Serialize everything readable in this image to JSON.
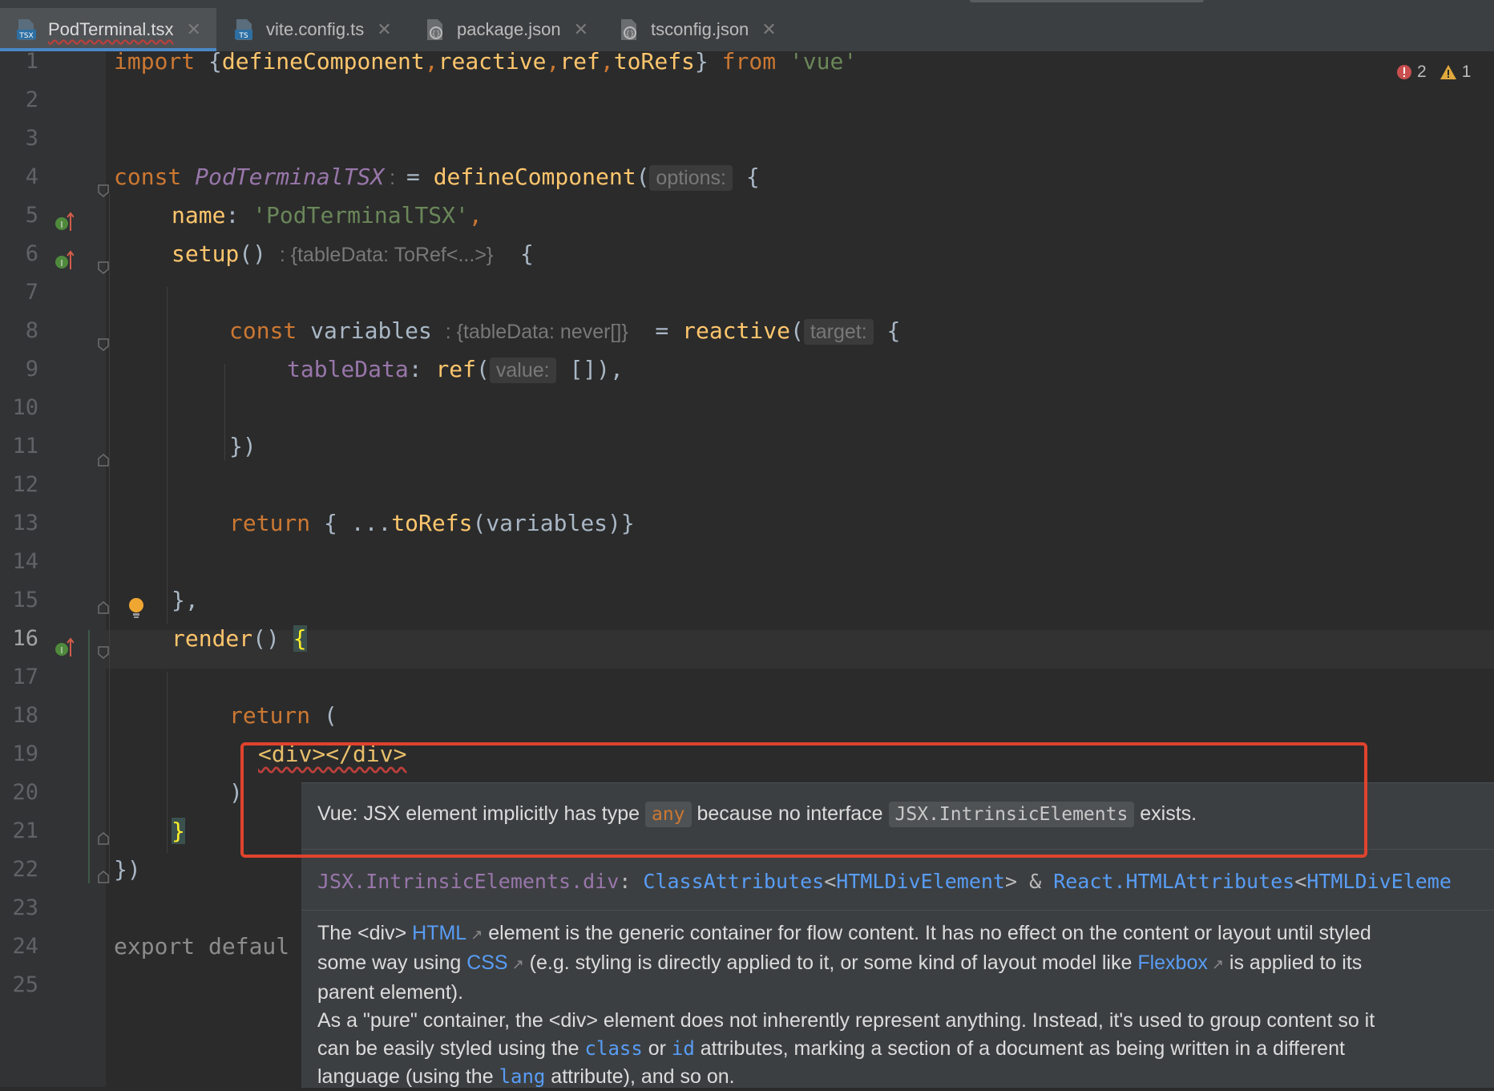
{
  "tabs": [
    {
      "label": "PodTerminal.tsx",
      "icon": "tsx-file-icon",
      "active": true
    },
    {
      "label": "vite.config.ts",
      "icon": "ts-file-icon",
      "active": false
    },
    {
      "label": "package.json",
      "icon": "json-config-icon",
      "active": false
    },
    {
      "label": "tsconfig.json",
      "icon": "json-config-icon",
      "active": false
    }
  ],
  "tab_close": "✕",
  "line_numbers": [
    "1",
    "2",
    "3",
    "4",
    "5",
    "6",
    "7",
    "8",
    "9",
    "10",
    "11",
    "12",
    "13",
    "14",
    "15",
    "16",
    "17",
    "18",
    "19",
    "20",
    "21",
    "22",
    "23",
    "24",
    "25"
  ],
  "current_line": "16",
  "inspections": {
    "errors": "2",
    "warnings": "1"
  },
  "code": {
    "l1": {
      "import": "import",
      "braces_open": " {",
      "names": "defineComponent",
      "c1": ",",
      "n2": "reactive",
      "c2": ",",
      "n3": "ref",
      "c3": ",",
      "n4": "toRefs",
      "braces_close": "} ",
      "from": "from",
      "module": " 'vue'"
    },
    "l4": {
      "const": "const ",
      "name": "PodTerminalTSX",
      "colon": " :  ",
      "eq": "= ",
      "fn": "defineComponent",
      "paren": "(",
      "hint": "options:",
      "brace": " {"
    },
    "l5": {
      "key": "name",
      "colon": ": ",
      "value": "'PodTerminalTSX'",
      "comma": ","
    },
    "l6": {
      "fn": "setup",
      "parens": "() ",
      "hint": ": {tableData: ToRef<...>}",
      "brace": "  {"
    },
    "l8": {
      "const": "const ",
      "name": "variables ",
      "hint": ": {tableData: never[]}",
      "eq": "  = ",
      "fn": "reactive",
      "paren": "(",
      "hint2": "target:",
      "brace": " {"
    },
    "l9": {
      "key": "tableData",
      "colon": ": ",
      "fn": "ref",
      "paren": "(",
      "hint": "value:",
      "rest": " []),"
    },
    "l11": {
      "text": "})"
    },
    "l13": {
      "ret": "return",
      "open": " { ...",
      "fn": "toRefs",
      "rest": "(variables)}"
    },
    "l15": {
      "text": "},"
    },
    "l16": {
      "fn": "render",
      "parens": "() ",
      "brace": "{"
    },
    "l18": {
      "ret": "return",
      "rest": " ("
    },
    "l19": {
      "tag": "<div></div>"
    },
    "l20": {
      "text": ")"
    },
    "l21": {
      "text": "}"
    },
    "l22": {
      "text": "})"
    },
    "l24": {
      "text": "export defaul"
    }
  },
  "popup": {
    "error": {
      "p1": "Vue: JSX element implicitly has type ",
      "any": "any",
      "p2": " because no interface ",
      "iface": "JSX.IntrinsicElements",
      "p3": " exists."
    },
    "signature": {
      "name": "JSX.IntrinsicElements.div",
      "colon": ": ",
      "t1": "ClassAttributes",
      "lt1": "<",
      "t2": "HTMLDivElement",
      "gt1": "> & ",
      "t3": "React.HTMLAttributes",
      "lt2": "<",
      "t4": "HTMLDivEleme"
    },
    "doc": {
      "a1": "The <div> ",
      "html": "HTML",
      "a2": " element is the generic container for flow content. It has no effect on the content or layout until styled",
      "b1": "some way using ",
      "css": "CSS",
      "b2": " (e.g. styling is directly applied to it, or some kind of layout model like ",
      "flexbox": "Flexbox",
      "b3": " is applied to its",
      "c1": "parent element).",
      "d1": "As a \"pure\" container, the <div> element does not inherently represent anything. Instead, it's used to group content so it",
      "e1": "can be easily styled using the ",
      "cls": "class",
      "e2": " or ",
      "id": "id",
      "e3": " attributes, marking a section of a document as being written in a different",
      "f1": "language (using the ",
      "lang": "lang",
      "f2": " attribute), and so on."
    }
  }
}
